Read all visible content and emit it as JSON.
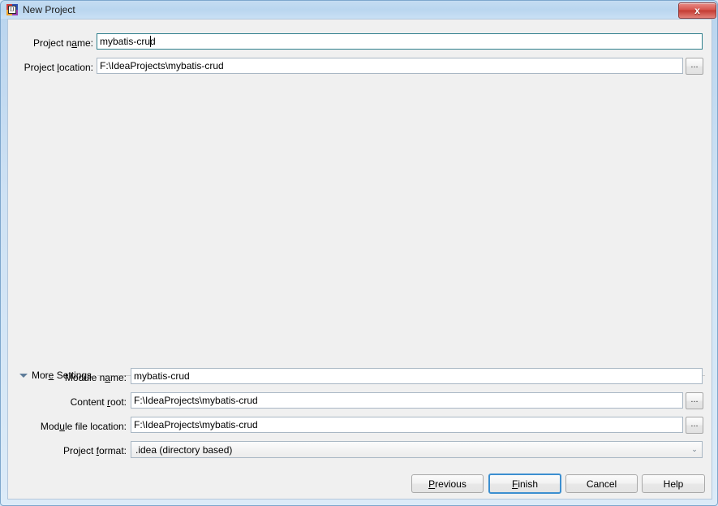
{
  "window": {
    "title": "New Project",
    "ghost_title": "",
    "icon": "intellij-idea-icon",
    "close_label": "x"
  },
  "form": {
    "project_name": {
      "label_pre": "Project n",
      "label_mnemonic": "a",
      "label_post": "me:",
      "value": "mybatis-crud"
    },
    "project_location": {
      "label_pre": "Project ",
      "label_mnemonic": "l",
      "label_post": "ocation:",
      "value": "F:\\IdeaProjects\\mybatis-crud"
    },
    "browse_label": "..."
  },
  "more_settings": {
    "label_pre": "Mor",
    "label_mnemonic": "e",
    "label_post": " Settings",
    "expanded": true
  },
  "settings": {
    "module_name": {
      "label_pre": "Module n",
      "label_mnemonic": "a",
      "label_post": "me:",
      "value": "mybatis-crud"
    },
    "content_root": {
      "label_pre": "Content ",
      "label_mnemonic": "r",
      "label_post": "oot:",
      "value": "F:\\IdeaProjects\\mybatis-crud"
    },
    "module_file_location": {
      "label_pre": "Mod",
      "label_mnemonic": "u",
      "label_post": "le file location:",
      "value": "F:\\IdeaProjects\\mybatis-crud"
    },
    "project_format": {
      "label_pre": "Project ",
      "label_mnemonic": "f",
      "label_post": "ormat:",
      "value": ".idea (directory based)",
      "chevron": "⌄"
    }
  },
  "buttons": {
    "previous": {
      "pre": "",
      "mnemonic": "P",
      "post": "revious"
    },
    "finish": {
      "pre": "",
      "mnemonic": "F",
      "post": "inish"
    },
    "cancel": {
      "pre": "Cancel",
      "mnemonic": "",
      "post": ""
    },
    "help": {
      "pre": "Help",
      "mnemonic": "",
      "post": ""
    }
  },
  "colors": {
    "accent_focus": "#3c8fd0",
    "field_focus_border": "#2f7f8c",
    "client_bg": "#f0f0f0",
    "close_red": "#c33b33"
  }
}
